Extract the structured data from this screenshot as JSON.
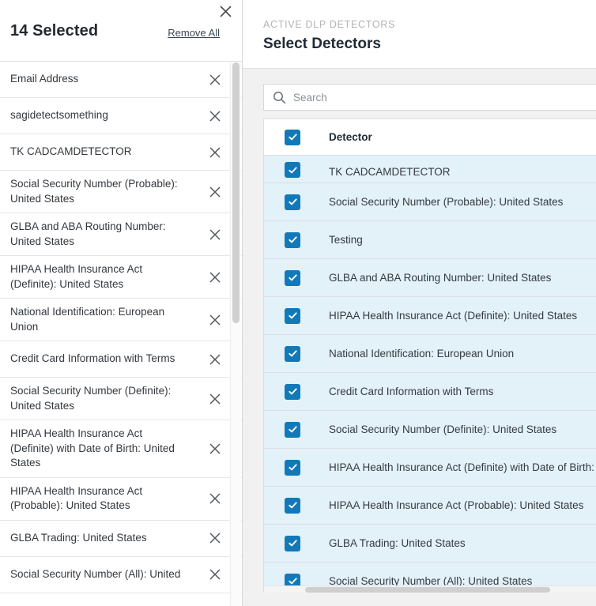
{
  "left_panel": {
    "close_icon": "close-icon",
    "count_label": "14 Selected",
    "remove_all_label": "Remove All",
    "remove_icon": "close-icon",
    "selected_items": [
      {
        "label": "Email Address"
      },
      {
        "label": "sagidetectsomething"
      },
      {
        "label": "TK CADCAMDETECTOR"
      },
      {
        "label": "Social Security Number (Probable): United States"
      },
      {
        "label": "GLBA and ABA Routing Number: United States"
      },
      {
        "label": "HIPAA Health Insurance Act (Definite): United States"
      },
      {
        "label": "National Identification: European Union"
      },
      {
        "label": "Credit Card Information with Terms"
      },
      {
        "label": "Social Security Number (Definite): United States"
      },
      {
        "label": "HIPAA Health Insurance Act (Definite) with Date of Birth: United States"
      },
      {
        "label": "HIPAA Health Insurance Act (Probable): United States"
      },
      {
        "label": "GLBA Trading: United States"
      },
      {
        "label": "Social Security Number (All): United"
      }
    ]
  },
  "right_panel": {
    "eyebrow": "ACTIVE DLP DETECTORS",
    "title": "Select Detectors",
    "search": {
      "icon": "search-icon",
      "value": "",
      "placeholder": "Search"
    },
    "table": {
      "header": {
        "checkbox_checked": true,
        "column_label": "Detector"
      },
      "rows": [
        {
          "label": "TK CADCAMDETECTOR",
          "checked": true
        },
        {
          "label": "Social Security Number (Probable): United States",
          "checked": true
        },
        {
          "label": "Testing",
          "checked": true
        },
        {
          "label": "GLBA and ABA Routing Number: United States",
          "checked": true
        },
        {
          "label": "HIPAA Health Insurance Act (Definite): United States",
          "checked": true
        },
        {
          "label": "National Identification: European Union",
          "checked": true
        },
        {
          "label": "Credit Card Information with Terms",
          "checked": true
        },
        {
          "label": "Social Security Number (Definite): United States",
          "checked": true
        },
        {
          "label": "HIPAA Health Insurance Act (Definite) with Date of Birth: United States",
          "checked": true
        },
        {
          "label": "HIPAA Health Insurance Act (Probable): United States",
          "checked": true
        },
        {
          "label": "GLBA Trading: United States",
          "checked": true
        },
        {
          "label": "Social Security Number (All): United States",
          "checked": true
        }
      ]
    }
  },
  "colors": {
    "accent_blue": "#1279b9",
    "row_selected_bg": "#e3f1f9",
    "panel_bg": "#f1f1f1",
    "text_primary": "#212b36",
    "text_secondary": "#33383d",
    "eyebrow_gray": "#b4b4b4"
  }
}
